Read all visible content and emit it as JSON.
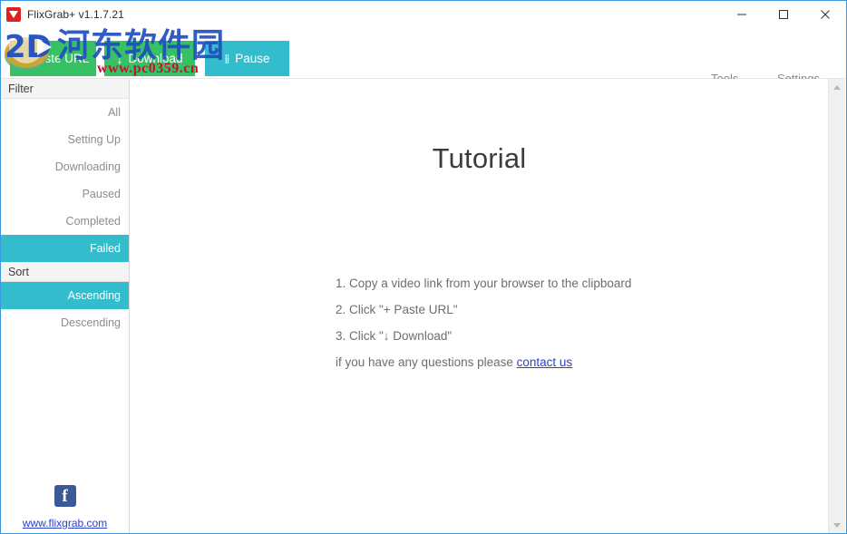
{
  "window": {
    "title": "FlixGrab+ v1.1.7.21",
    "app_icon": "flixgrab-icon",
    "controls": {
      "minimize": "minimize-icon",
      "maximize": "maximize-icon",
      "close": "close-icon"
    }
  },
  "toolbar": {
    "paste_url": {
      "glyph": "+",
      "label": "Paste URL",
      "color": "#35c164"
    },
    "download": {
      "glyph": "↓",
      "label": "Download",
      "color": "#35c164"
    },
    "pause": {
      "glyph": "‖",
      "label": "Pause",
      "color": "#33bccb"
    },
    "tools": {
      "label": "Tools",
      "caret": "chevron-down-icon"
    },
    "settings": {
      "label": "Settings",
      "caret": "chevron-down-icon"
    }
  },
  "sidebar": {
    "filter_header": "Filter",
    "filter_items": [
      {
        "label": "All",
        "active": false
      },
      {
        "label": "Setting Up",
        "active": false
      },
      {
        "label": "Downloading",
        "active": false
      },
      {
        "label": "Paused",
        "active": false
      },
      {
        "label": "Completed",
        "active": false
      },
      {
        "label": "Failed",
        "active": true
      }
    ],
    "sort_header": "Sort",
    "sort_items": [
      {
        "label": "Ascending",
        "active": true
      },
      {
        "label": "Descending",
        "active": false
      }
    ],
    "facebook_letter": "f",
    "site_link": "www.flixgrab.com"
  },
  "main": {
    "title": "Tutorial",
    "steps": [
      "1. Copy a video link from your browser to the clipboard",
      "2. Click \"+ Paste URL\"",
      "3. Click \"↓ Download\""
    ],
    "question_prefix": "if you have any questions please ",
    "contact_link": "contact us"
  },
  "scrollbar": {
    "up": "scroll-up-arrow-icon",
    "down": "scroll-down-arrow-icon"
  },
  "watermark": {
    "text_cn": "河东软件园",
    "url": "www.pc0359.cn"
  },
  "colors": {
    "green": "#35c164",
    "teal": "#33bccb",
    "link": "#2b41c9",
    "window_border": "#3a96dd"
  }
}
